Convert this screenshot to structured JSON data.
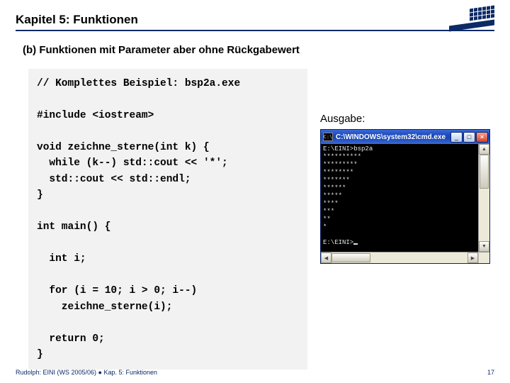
{
  "header": {
    "title": "Kapitel 5: Funktionen"
  },
  "subheading": "(b) Funktionen mit Parameter aber ohne Rückgabewert",
  "code": "// Komplettes Beispiel: bsp2a.exe\n\n#include <iostream>\n\nvoid zeichne_sterne(int k) {\n  while (k--) std::cout << '*';\n  std::cout << std::endl;\n}\n\nint main() {\n\n  int i;\n\n  for (i = 10; i > 0; i--)\n    zeichne_sterne(i);\n\n  return 0;\n}",
  "output": {
    "label": "Ausgabe:",
    "window_title": "C:\\WINDOWS\\system32\\cmd.exe",
    "icon_text": "C:\\",
    "prompt1": "E:\\EINI>",
    "command": "bsp2a",
    "lines": [
      "**********",
      "*********",
      "********",
      "*******",
      "******",
      "*****",
      "****",
      "***",
      "**",
      "*",
      ""
    ],
    "prompt2": "E:\\EINI>",
    "buttons": {
      "min": "_",
      "max": "□",
      "close": "×"
    },
    "scroll": {
      "up": "▲",
      "down": "▼",
      "left": "◀",
      "right": "▶"
    }
  },
  "footer": {
    "left": "Rudolph: EINI (WS 2005/06)  ●  Kap. 5: Funktionen",
    "page": "17"
  }
}
